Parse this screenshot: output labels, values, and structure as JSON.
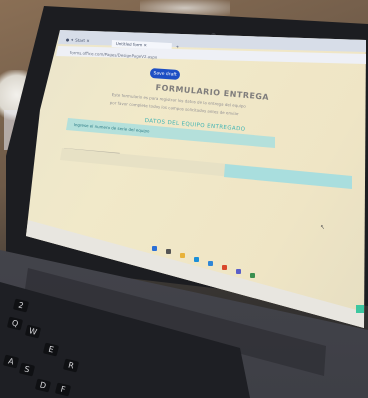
{
  "browser": {
    "tabs": [
      {
        "label": "● ✦ Start ✕"
      },
      {
        "label": "Untitled form ✕"
      }
    ],
    "add_tab": "+",
    "url": "forms.office.com/Pages/DesignPageV2.aspx"
  },
  "form": {
    "save_label": "Save draft",
    "title": "FORMULARIO ENTREGA",
    "description_lines": [
      "Este formulario es para registrar los datos de la entrega del equipo",
      "por favor complete todos los campos solicitados antes de enviar"
    ],
    "section_title": "DATOS DEL EQUIPO ENTREGADO",
    "banner_text": "Ingrese el numero de serie del equipo",
    "progress": 0.55
  },
  "taskbar": {
    "icons": [
      "windows-icon",
      "search-icon",
      "explorer-icon",
      "edge-icon",
      "mail-icon",
      "chrome-icon",
      "teams-icon",
      "store-icon"
    ]
  },
  "keyboard": {
    "keys": [
      "2",
      "Q",
      "W",
      "E",
      "R",
      "A",
      "S",
      "D",
      "F"
    ]
  },
  "colors": {
    "save_button": "#1d4fc4",
    "accent_teal": "#3fb3b3",
    "banner": "#a9dede"
  }
}
